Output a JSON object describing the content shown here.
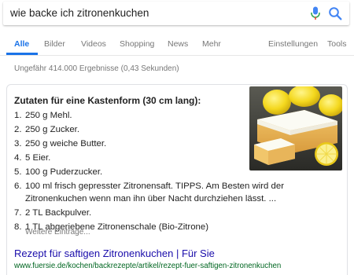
{
  "search": {
    "query": "wie backe ich zitronenkuchen",
    "mic_icon": "microphone-icon",
    "search_icon": "search-icon",
    "colors": {
      "mic_blue": "#4285f4",
      "mic_red": "#ea4335",
      "search_blue": "#4285f4"
    }
  },
  "tabs": {
    "items": [
      {
        "label": "Alle",
        "active": true
      },
      {
        "label": "Bilder"
      },
      {
        "label": "Videos"
      },
      {
        "label": "Shopping"
      },
      {
        "label": "News"
      },
      {
        "label": "Mehr"
      }
    ],
    "settings_label": "Einstellungen",
    "tools_label": "Tools",
    "accent_color": "#1a73e8"
  },
  "results_stats": "Ungefähr 414.000 Ergebnisse (0,43 Sekunden)",
  "snippet": {
    "heading": "Zutaten für eine Kastenform (30 cm lang):",
    "items": [
      {
        "num": "1.",
        "text": "250 g Mehl."
      },
      {
        "num": "2.",
        "text": "250 g Zucker."
      },
      {
        "num": "3.",
        "text": "250 g weiche Butter."
      },
      {
        "num": "4.",
        "text": "5 Eier."
      },
      {
        "num": "5.",
        "text": "100 g Puderzucker."
      },
      {
        "num": "6.",
        "text": "100 ml frisch gepresster Zitronensaft. TIPPS. Am Besten wird der Zitronenkuchen wenn man ihn über Nacht durchziehen lässt. ..."
      },
      {
        "num": "7.",
        "text": "2 TL Backpulver."
      },
      {
        "num": "8.",
        "text": "1 TL abgeriebene Zitronenschale (Bio-Zitrone)"
      }
    ],
    "more_label": "Weitere Einträge...",
    "image_icon": "lemon-cake-photo"
  },
  "result": {
    "title": "Rezept für saftigen Zitronenkuchen | Für Sie",
    "url": "www.fuersie.de/kochen/backrezepte/artikel/rezept-fuer-saftigen-zitronenkuchen",
    "title_color": "#1a0dab",
    "url_color": "#006621"
  }
}
